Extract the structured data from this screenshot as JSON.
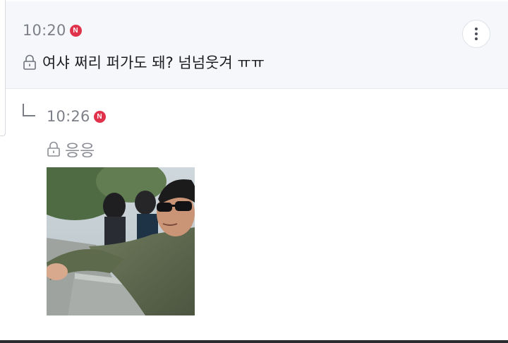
{
  "post": {
    "time": "10:20",
    "new_badge": "N",
    "message": "여샤 쩌리 퍼가도 돼?  넘넘웃겨 ㅠㅠ",
    "icons": {
      "lock": "lock-icon",
      "more": "more-vertical-icon"
    }
  },
  "reply": {
    "time": "10:26",
    "new_badge": "N",
    "message": "응응",
    "icons": {
      "arrow": "reply-arrow-icon",
      "lock": "lock-icon"
    }
  },
  "colors": {
    "badge": "#e0324a",
    "post_background": "#f5f7fb"
  }
}
